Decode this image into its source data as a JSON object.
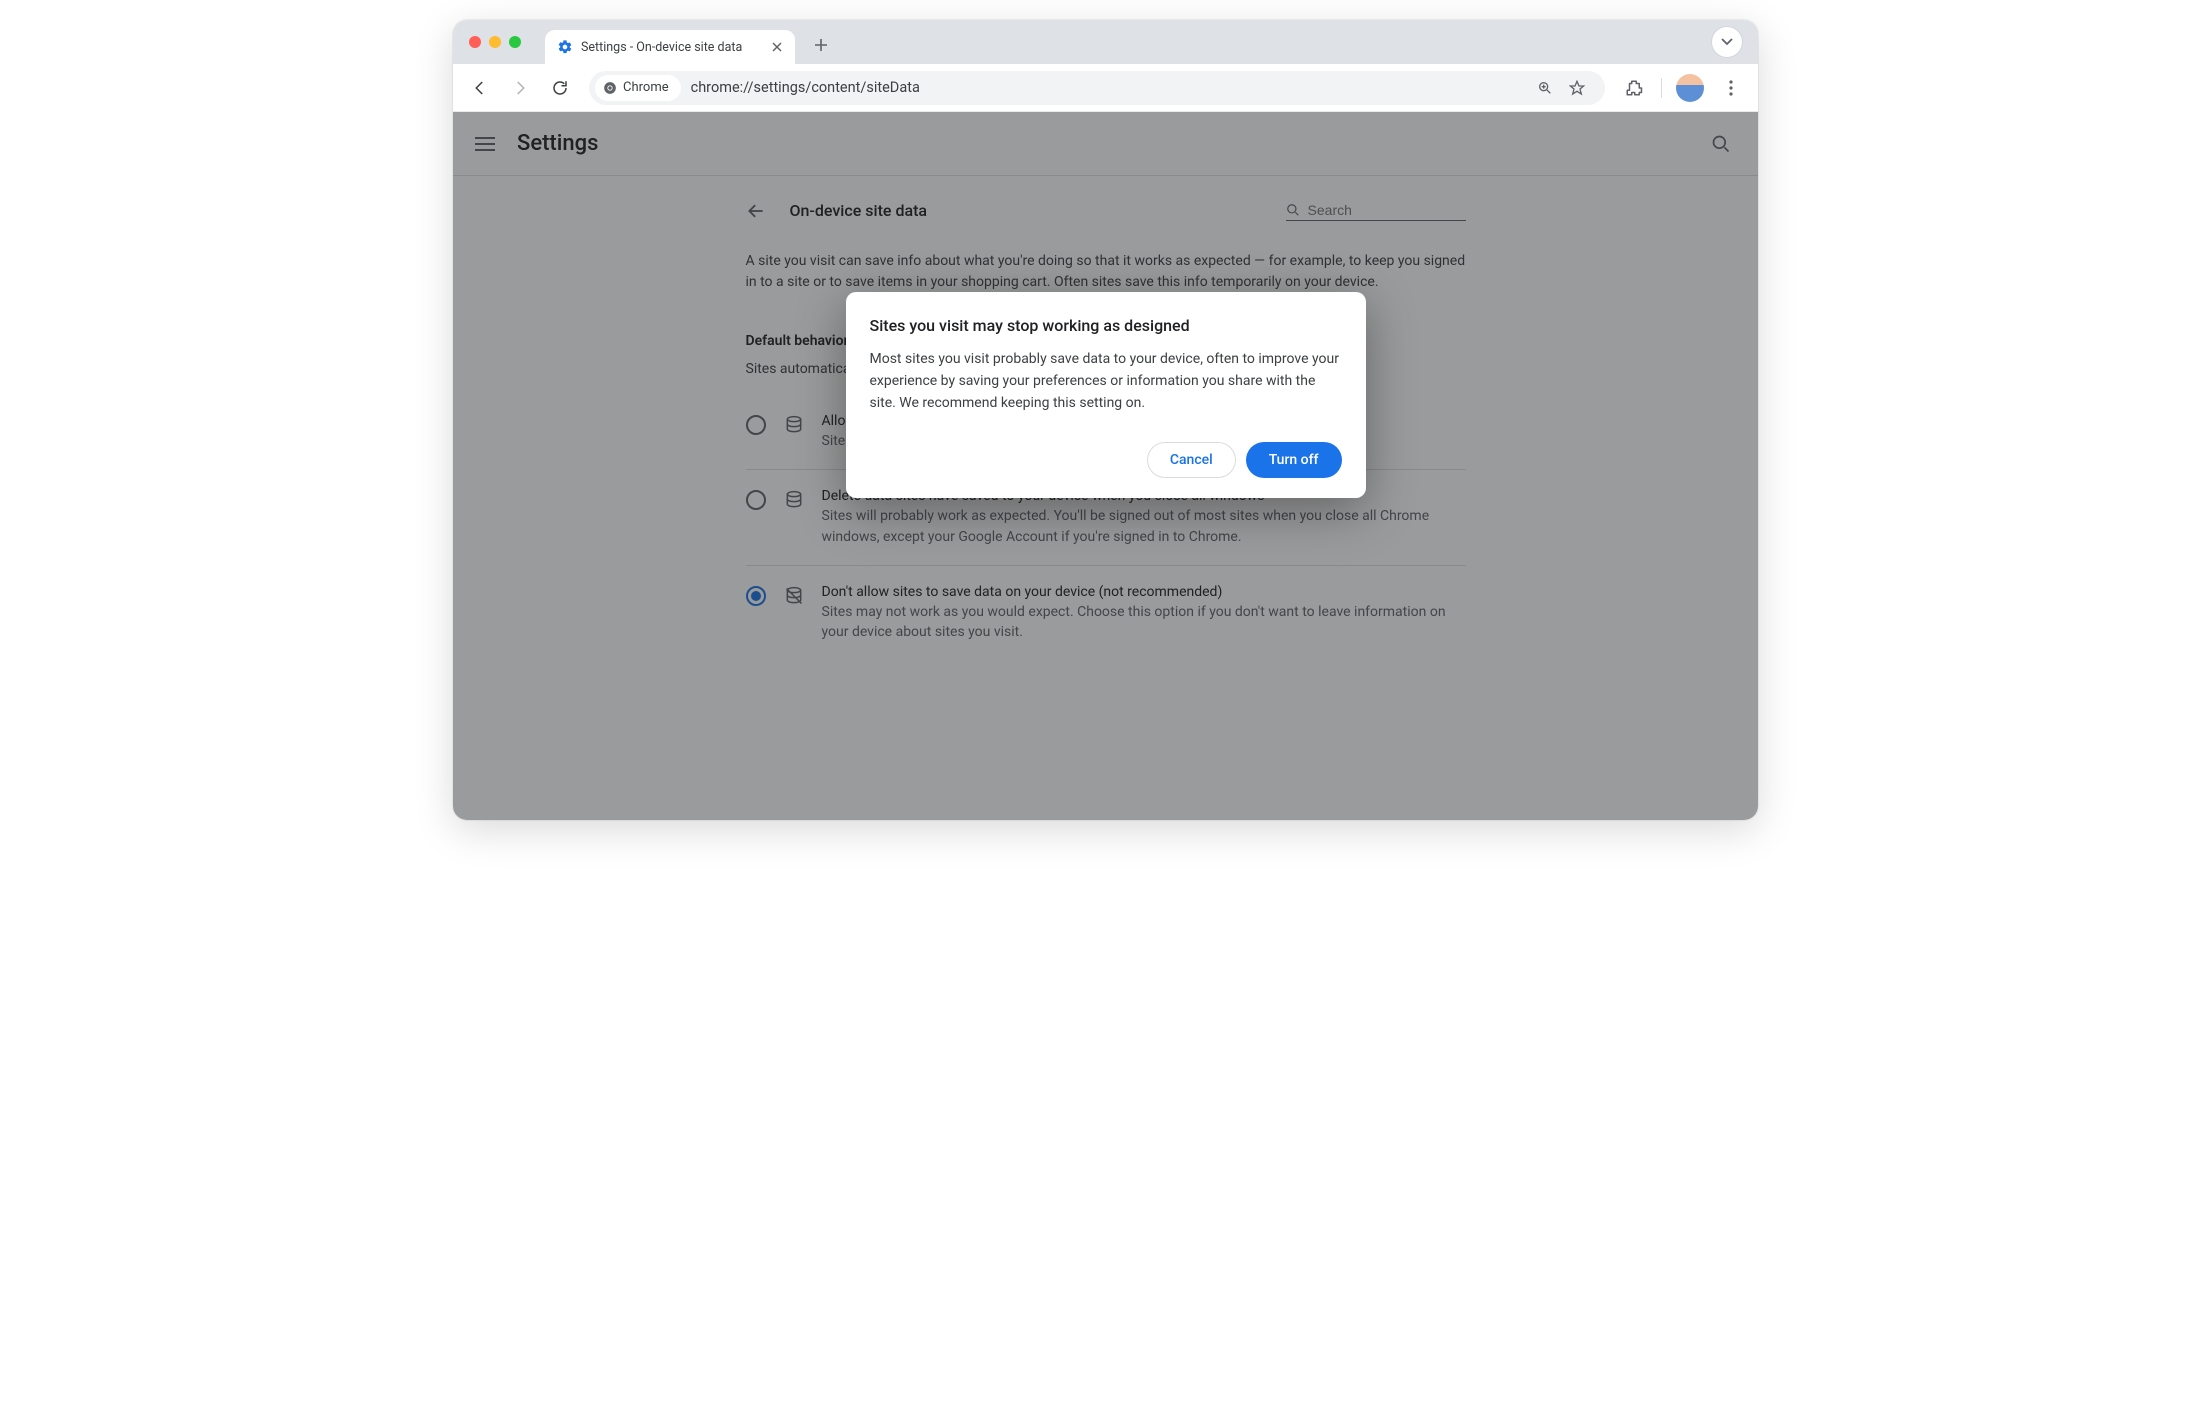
{
  "tab": {
    "title": "Settings - On-device site data"
  },
  "omnibox": {
    "chip_label": "Chrome",
    "url": "chrome://settings/content/siteData"
  },
  "settings": {
    "app_title": "Settings",
    "page_title": "On-device site data",
    "search_placeholder": "Search",
    "description": "A site you visit can save info about what you're doing so that it works as expected — for example, to keep you signed in to a site or to save items in your shopping cart. Often sites save this info temporarily on your device.",
    "default_behavior_heading": "Default behavior",
    "default_behavior_sub": "Sites automatically follow this setting when you visit them",
    "options": [
      {
        "title": "Allow sites to save data on your device",
        "desc": "Sites will work as expected.",
        "selected": false,
        "icon": "database"
      },
      {
        "title": "Delete data sites have saved to your device when you close all windows",
        "desc": "Sites will probably work as expected. You'll be signed out of most sites when you close all Chrome windows, except your Google Account if you're signed in to Chrome.",
        "selected": false,
        "icon": "database"
      },
      {
        "title": "Don't allow sites to save data on your device (not recommended)",
        "desc": "Sites may not work as you would expect. Choose this option if you don't want to leave information on your device about sites you visit.",
        "selected": true,
        "icon": "database-off"
      }
    ]
  },
  "dialog": {
    "title": "Sites you visit may stop working as designed",
    "body": "Most sites you visit probably save data to your device, often to improve your experience by saving your preferences or information you share with the site. We recommend keeping this setting on.",
    "cancel": "Cancel",
    "confirm": "Turn off"
  }
}
